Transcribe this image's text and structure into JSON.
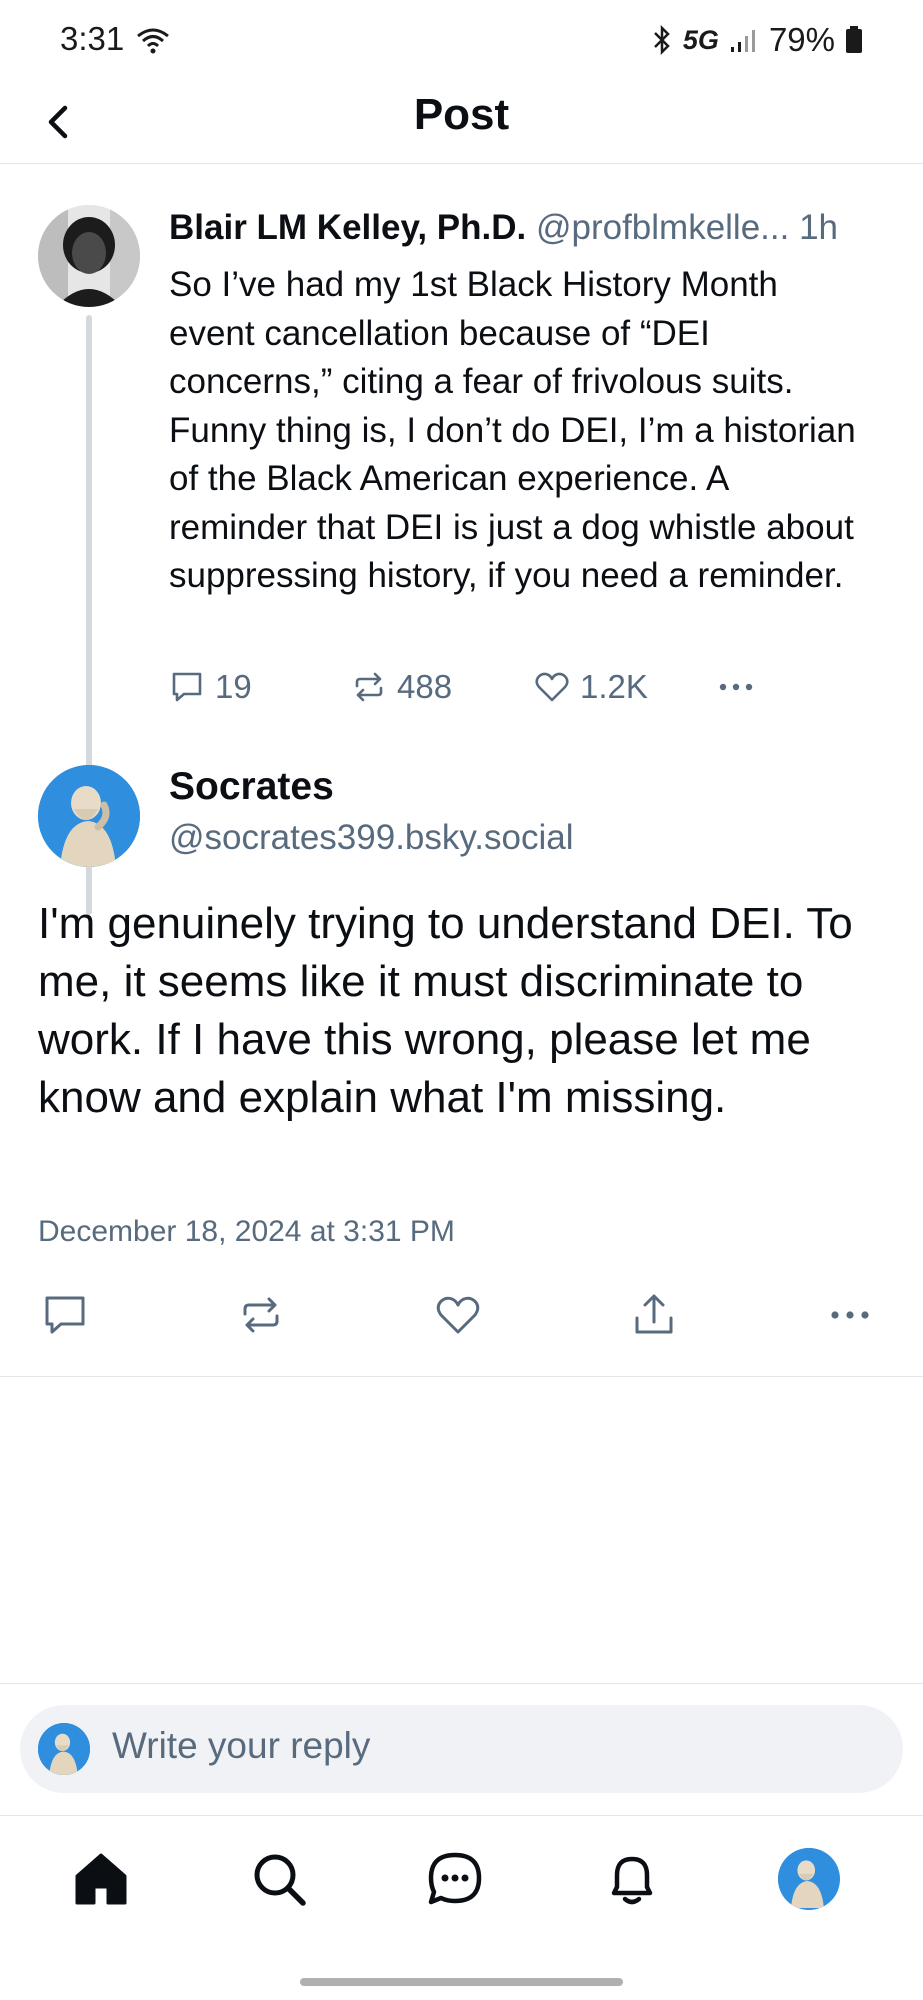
{
  "status_bar": {
    "time": "3:31",
    "network": "5G",
    "battery": "79%"
  },
  "header": {
    "title": "Post"
  },
  "parent_post": {
    "author_name": "Blair LM Kelley, Ph.D.",
    "author_handle": "@profblmkelle...",
    "time": "1h",
    "text": "So I’ve had my 1st Black History Month event cancellation because of “DEI concerns,” citing a fear of frivolous suits. Funny thing is, I don’t do DEI, I’m a historian of the Black American experience. A reminder that DEI is just a dog whistle about suppressing history, if you need a reminder.",
    "replies": "19",
    "reposts": "488",
    "likes": "1.2K"
  },
  "main_post": {
    "author_name": "Socrates",
    "author_handle": "@socrates399.bsky.social",
    "text": "I'm genuinely trying to understand DEI. To me, it seems like it must discriminate to work. If I have this wrong, please let me know and explain what I'm missing.",
    "date": "December 18, 2024 at 3:31 PM"
  },
  "reply_composer": {
    "placeholder": "Write your reply"
  },
  "icons": {
    "back": "chevron-left-icon",
    "reply": "speech-bubble-icon",
    "repost": "repost-icon",
    "like": "heart-icon",
    "share": "share-icon",
    "more": "ellipsis-icon",
    "nav": [
      "home-icon",
      "search-icon",
      "chat-icon",
      "bell-icon",
      "profile-avatar"
    ]
  },
  "colors": {
    "text_primary": "#0b0f14",
    "text_secondary": "#586a7e",
    "divider": "#e3e7ec",
    "composer_bg": "#f0f2f5",
    "avatar_bg": "#2f8ede"
  }
}
